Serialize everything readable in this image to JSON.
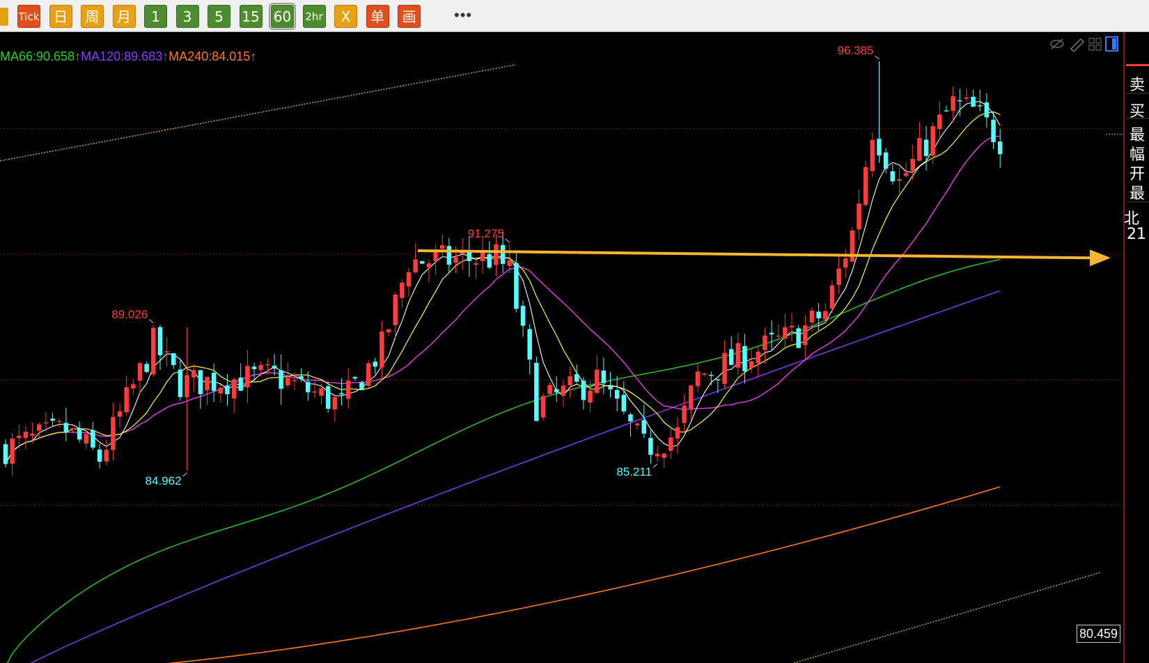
{
  "toolbar": {
    "buttons": [
      {
        "label": "Tick",
        "color": "red",
        "small": true
      },
      {
        "label": "日",
        "color": "orange"
      },
      {
        "label": "周",
        "color": "orange"
      },
      {
        "label": "月",
        "color": "orange"
      },
      {
        "label": "1",
        "color": "green"
      },
      {
        "label": "3",
        "color": "green"
      },
      {
        "label": "5",
        "color": "green"
      },
      {
        "label": "15",
        "color": "green"
      },
      {
        "label": "60",
        "color": "green",
        "active": true
      },
      {
        "label": "2hr",
        "color": "green",
        "small": true
      },
      {
        "label": "X",
        "color": "orange"
      },
      {
        "label": "单",
        "color": "red"
      },
      {
        "label": "画",
        "color": "red"
      }
    ],
    "more": "•••"
  },
  "ma_legend": [
    {
      "text": "MA66:90.658↑",
      "color": "#25d025"
    },
    {
      "text": "MA120:89.683↑",
      "color": "#8a3dff"
    },
    {
      "text": "MA240:84.015↑",
      "color": "#ff7a1a"
    }
  ],
  "right_panel": {
    "labels": [
      "卖",
      "买",
      "最",
      "幅",
      "开",
      "最",
      "北",
      "21"
    ]
  },
  "last_price_tag": "80.459",
  "chart_data": {
    "type": "candlestick",
    "title": "",
    "xlabel": "",
    "ylabel": "",
    "ylim": [
      79.6,
      97.2
    ],
    "grid": "dotted horizontal",
    "colors": {
      "up": "#ff3b3b",
      "down": "#54ffff",
      "ma_fast": "#ffffff",
      "ma_mid": "#ffff33",
      "ma_slow": "#ff40ff",
      "ma66": "#25d025",
      "ma120": "#8a3dff",
      "ma240": "#ff7a1a",
      "trend_arrow": "#f5b731"
    },
    "annotations": [
      {
        "label": "96.385",
        "value": 96.385,
        "kind": "high"
      },
      {
        "label": "91.275",
        "value": 91.275,
        "kind": "high"
      },
      {
        "label": "89.026",
        "value": 89.026,
        "kind": "high"
      },
      {
        "label": "84.962",
        "value": 84.962,
        "kind": "low"
      },
      {
        "label": "85.211",
        "value": 85.211,
        "kind": "low"
      }
    ],
    "ma_values": {
      "MA66": 90.658,
      "MA120": 89.683,
      "MA240": 84.015
    }
  }
}
